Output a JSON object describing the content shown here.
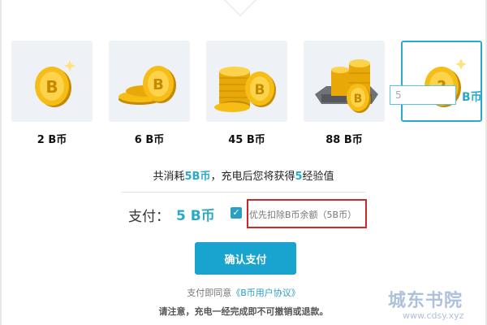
{
  "options": [
    {
      "label": "2 B币",
      "icon": "single-coin-icon"
    },
    {
      "label": "6 B币",
      "icon": "small-coin-pile-icon"
    },
    {
      "label": "45 B币",
      "icon": "coin-stack-icon"
    },
    {
      "label": "88 B币",
      "icon": "coin-treasure-icon"
    },
    {
      "label": "",
      "icon": "mystery-coin-icon"
    }
  ],
  "custom": {
    "value": "5",
    "unit": "B币"
  },
  "summary": {
    "prefix": "共消耗",
    "cost": "5B币",
    "middle": "，充电后您将获得",
    "exp": "5",
    "suffix": "经验值"
  },
  "payment": {
    "label": "支付：",
    "amount": "5 B币",
    "checked": true,
    "deduct_text": "优先扣除B币余额（5B币）"
  },
  "confirm_label": "确认支付",
  "agreement": {
    "prefix": "支付即同意",
    "link": "《B币用户协议》"
  },
  "notice": "请注意，充电一经完成即不可撤销或退款。",
  "watermark": {
    "main": "城东书院",
    "sub": "www.cdsy.xyz"
  },
  "colors": {
    "accent": "#2aa9c9",
    "button": "#19a4cf",
    "highlight_border": "#cc2a2a",
    "card_bg": "#eef1f5"
  }
}
